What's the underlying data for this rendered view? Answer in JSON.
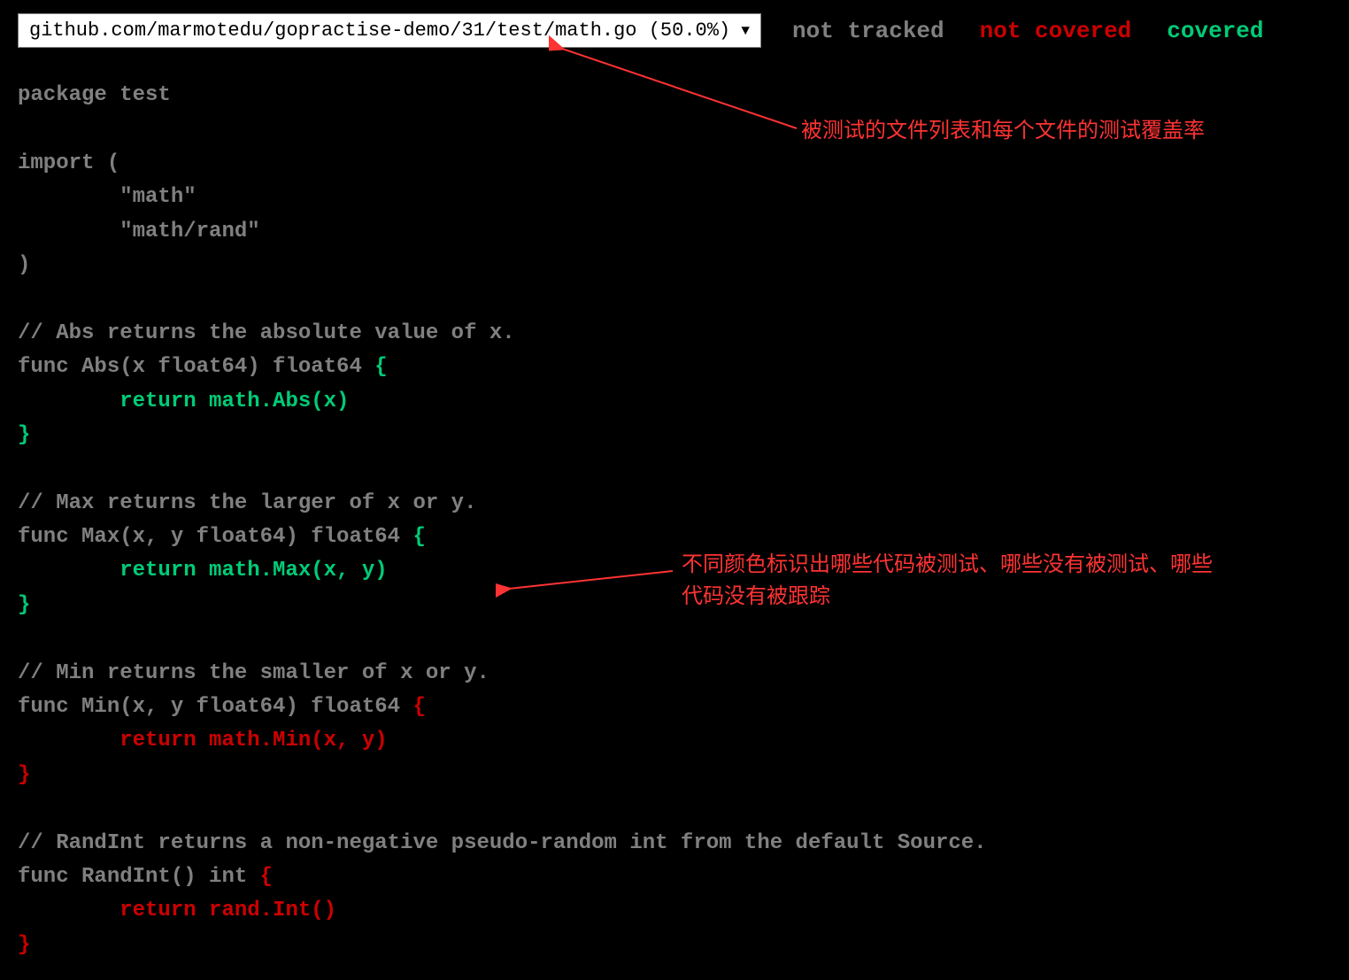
{
  "header": {
    "file_select_label": "github.com/marmotedu/gopractise-demo/31/test/math.go (50.0%)",
    "legend": {
      "not_tracked": "not tracked",
      "not_covered": "not covered",
      "covered": "covered"
    }
  },
  "code": {
    "lines": [
      {
        "class": "c-tracked",
        "text": "package test"
      },
      {
        "class": "c-tracked",
        "text": ""
      },
      {
        "class": "c-tracked",
        "text": "import ("
      },
      {
        "class": "c-tracked",
        "text": "        \"math\""
      },
      {
        "class": "c-tracked",
        "text": "        \"math/rand\""
      },
      {
        "class": "c-tracked",
        "text": ")"
      },
      {
        "class": "c-tracked",
        "text": ""
      },
      {
        "class": "c-tracked",
        "text": "// Abs returns the absolute value of x."
      },
      {
        "class": "mixed",
        "segments": [
          {
            "class": "c-tracked",
            "text": "func Abs(x float64) float64 "
          },
          {
            "class": "c-covered",
            "text": "{"
          }
        ]
      },
      {
        "class": "c-covered",
        "text": "        return math.Abs(x)"
      },
      {
        "class": "c-covered",
        "text": "}"
      },
      {
        "class": "c-tracked",
        "text": ""
      },
      {
        "class": "c-tracked",
        "text": "// Max returns the larger of x or y."
      },
      {
        "class": "mixed",
        "segments": [
          {
            "class": "c-tracked",
            "text": "func Max(x, y float64) float64 "
          },
          {
            "class": "c-covered",
            "text": "{"
          }
        ]
      },
      {
        "class": "c-covered",
        "text": "        return math.Max(x, y)"
      },
      {
        "class": "c-covered",
        "text": "}"
      },
      {
        "class": "c-tracked",
        "text": ""
      },
      {
        "class": "c-tracked",
        "text": "// Min returns the smaller of x or y."
      },
      {
        "class": "mixed",
        "segments": [
          {
            "class": "c-tracked",
            "text": "func Min(x, y float64) float64 "
          },
          {
            "class": "c-notcovered",
            "text": "{"
          }
        ]
      },
      {
        "class": "c-notcovered",
        "text": "        return math.Min(x, y)"
      },
      {
        "class": "c-notcovered",
        "text": "}"
      },
      {
        "class": "c-tracked",
        "text": ""
      },
      {
        "class": "c-tracked",
        "text": "// RandInt returns a non-negative pseudo-random int from the default Source."
      },
      {
        "class": "mixed",
        "segments": [
          {
            "class": "c-tracked",
            "text": "func RandInt() int "
          },
          {
            "class": "c-notcovered",
            "text": "{"
          }
        ]
      },
      {
        "class": "c-notcovered",
        "text": "        return rand.Int()"
      },
      {
        "class": "c-notcovered",
        "text": "}"
      }
    ]
  },
  "annotations": {
    "anno1": "被测试的文件列表和每个文件的测试覆盖率",
    "anno2": "不同颜色标识出哪些代码被测试、哪些没有被测试、哪些代码没有被跟踪"
  },
  "colors": {
    "background": "#000000",
    "not_tracked": "#808080",
    "not_covered": "#cc0000",
    "covered": "#00cc77",
    "annotation": "#ff3333"
  }
}
